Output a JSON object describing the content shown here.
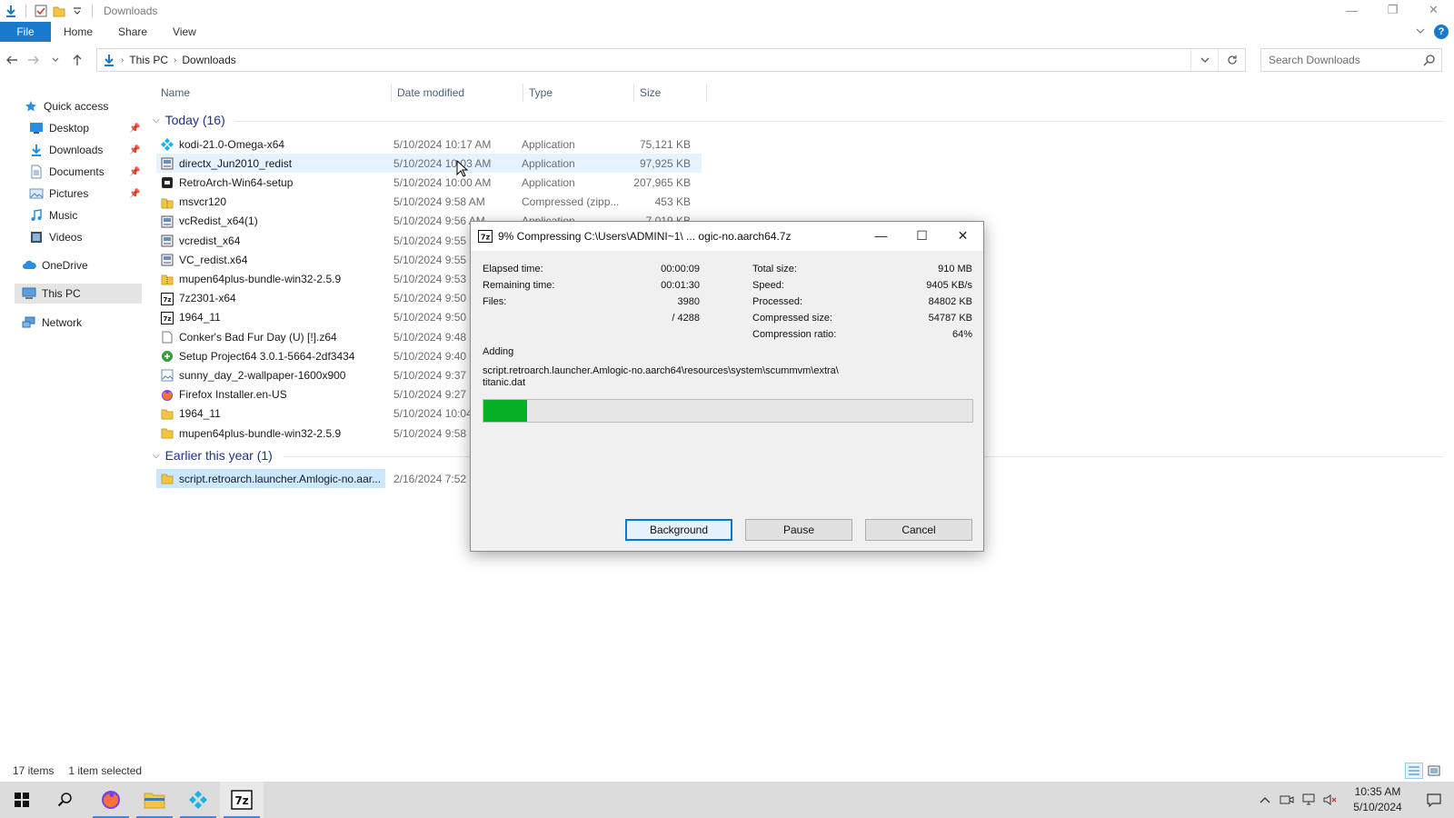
{
  "window": {
    "title": "Downloads",
    "minimize_glyph": "—",
    "restore_glyph": "❐",
    "close_glyph": "✕"
  },
  "ribbon": {
    "tabs": [
      "File",
      "Home",
      "Share",
      "View"
    ]
  },
  "address": {
    "crumbs": [
      "This PC",
      "Downloads"
    ],
    "search_placeholder": "Search Downloads"
  },
  "nav": {
    "items": [
      {
        "label": "Quick access",
        "icon": "star-icon"
      },
      {
        "label": "Desktop",
        "icon": "desktop-folder-icon",
        "pinned": true
      },
      {
        "label": "Downloads",
        "icon": "downloads-folder-icon",
        "pinned": true
      },
      {
        "label": "Documents",
        "icon": "documents-folder-icon",
        "pinned": true
      },
      {
        "label": "Pictures",
        "icon": "pictures-folder-icon",
        "pinned": true
      },
      {
        "label": "Music",
        "icon": "music-icon"
      },
      {
        "label": "Videos",
        "icon": "videos-icon"
      },
      {
        "label": "OneDrive",
        "icon": "onedrive-cloud-icon"
      },
      {
        "label": "This PC",
        "icon": "this-pc-icon",
        "selected": true
      },
      {
        "label": "Network",
        "icon": "network-icon"
      }
    ]
  },
  "columns": {
    "name": "Name",
    "date": "Date modified",
    "type": "Type",
    "size": "Size"
  },
  "groups": {
    "today": "Today (16)",
    "earlier": "Earlier this year (1)"
  },
  "files_today": [
    {
      "name": "kodi-21.0-Omega-x64",
      "date": "5/10/2024 10:17 AM",
      "type": "Application",
      "size": "75,121 KB",
      "icon": "kodi-app-icon"
    },
    {
      "name": "directx_Jun2010_redist",
      "date": "5/10/2024 10:03 AM",
      "type": "Application",
      "size": "97,925 KB",
      "icon": "installer-app-icon",
      "hover": true
    },
    {
      "name": "RetroArch-Win64-setup",
      "date": "5/10/2024 10:00 AM",
      "type": "Application",
      "size": "207,965 KB",
      "icon": "retroarch-app-icon"
    },
    {
      "name": "msvcr120",
      "date": "5/10/2024 9:58 AM",
      "type": "Compressed (zipp...",
      "size": "453 KB",
      "icon": "zip-folder-icon"
    },
    {
      "name": "vcRedist_x64(1)",
      "date": "5/10/2024 9:56 AM",
      "type": "Application",
      "size": "7,019 KB",
      "icon": "installer-app-icon"
    },
    {
      "name": "vcredist_x64",
      "date": "5/10/2024 9:55",
      "type": "",
      "size": "",
      "icon": "installer-app-icon"
    },
    {
      "name": "VC_redist.x64",
      "date": "5/10/2024 9:55",
      "type": "",
      "size": "",
      "icon": "installer-app-icon"
    },
    {
      "name": "mupen64plus-bundle-win32-2.5.9",
      "date": "5/10/2024 9:53",
      "type": "",
      "size": "",
      "icon": "zip-folder-icon"
    },
    {
      "name": "7z2301-x64",
      "date": "5/10/2024 9:50",
      "type": "",
      "size": "",
      "icon": "sevenzip-app-icon"
    },
    {
      "name": "1964_11",
      "date": "5/10/2024 9:50",
      "type": "",
      "size": "",
      "icon": "sevenzip-app-icon"
    },
    {
      "name": "Conker's Bad Fur Day (U) [!].z64",
      "date": "5/10/2024 9:48",
      "type": "",
      "size": "",
      "icon": "blank-file-icon"
    },
    {
      "name": "Setup Project64 3.0.1-5664-2df3434",
      "date": "5/10/2024 9:40",
      "type": "",
      "size": "",
      "icon": "project64-app-icon"
    },
    {
      "name": "sunny_day_2-wallpaper-1600x900",
      "date": "5/10/2024 9:37",
      "type": "",
      "size": "",
      "icon": "image-file-icon"
    },
    {
      "name": "Firefox Installer.en-US",
      "date": "5/10/2024 9:27",
      "type": "",
      "size": "",
      "icon": "firefox-app-icon"
    },
    {
      "name": "1964_11",
      "date": "5/10/2024 10:04",
      "type": "",
      "size": "",
      "icon": "folder-icon"
    },
    {
      "name": "mupen64plus-bundle-win32-2.5.9",
      "date": "5/10/2024 9:58",
      "type": "",
      "size": "",
      "icon": "folder-icon"
    }
  ],
  "files_earlier": [
    {
      "name": "script.retroarch.launcher.Amlogic-no.aar...",
      "date": "2/16/2024 7:52",
      "icon": "folder-icon",
      "selected": true
    }
  ],
  "status": {
    "count": "17 items",
    "selected": "1 item selected"
  },
  "taskbar": {
    "time": "10:35 AM",
    "date": "5/10/2024"
  },
  "dialog": {
    "title": "9% Compressing C:\\Users\\ADMINI~1\\ ... ogic-no.aarch64.7z",
    "percent": 9,
    "left_stats": [
      {
        "label": "Elapsed time:",
        "value": "00:00:09"
      },
      {
        "label": "Remaining time:",
        "value": "00:01:30"
      },
      {
        "label": "Files:",
        "value": "3980"
      },
      {
        "label": "",
        "value": "/ 4288"
      }
    ],
    "right_stats": [
      {
        "label": "Total size:",
        "value": "910 MB"
      },
      {
        "label": "Speed:",
        "value": "9405 KB/s"
      },
      {
        "label": "Processed:",
        "value": "84802 KB"
      },
      {
        "label": "Compressed size:",
        "value": "54787 KB"
      },
      {
        "label": "Compression ratio:",
        "value": "64%"
      }
    ],
    "action": "Adding",
    "path_line1": "script.retroarch.launcher.Amlogic-no.aarch64\\resources\\system\\scummvm\\extra\\",
    "path_line2": "titanic.dat",
    "buttons": {
      "background": "Background",
      "pause": "Pause",
      "cancel": "Cancel"
    },
    "minimize_glyph": "—",
    "maximize_glyph": "☐",
    "close_glyph": "✕"
  },
  "colors": {
    "accent": "#1979ca",
    "progress": "#06b025",
    "group_header": "#1e3287"
  }
}
